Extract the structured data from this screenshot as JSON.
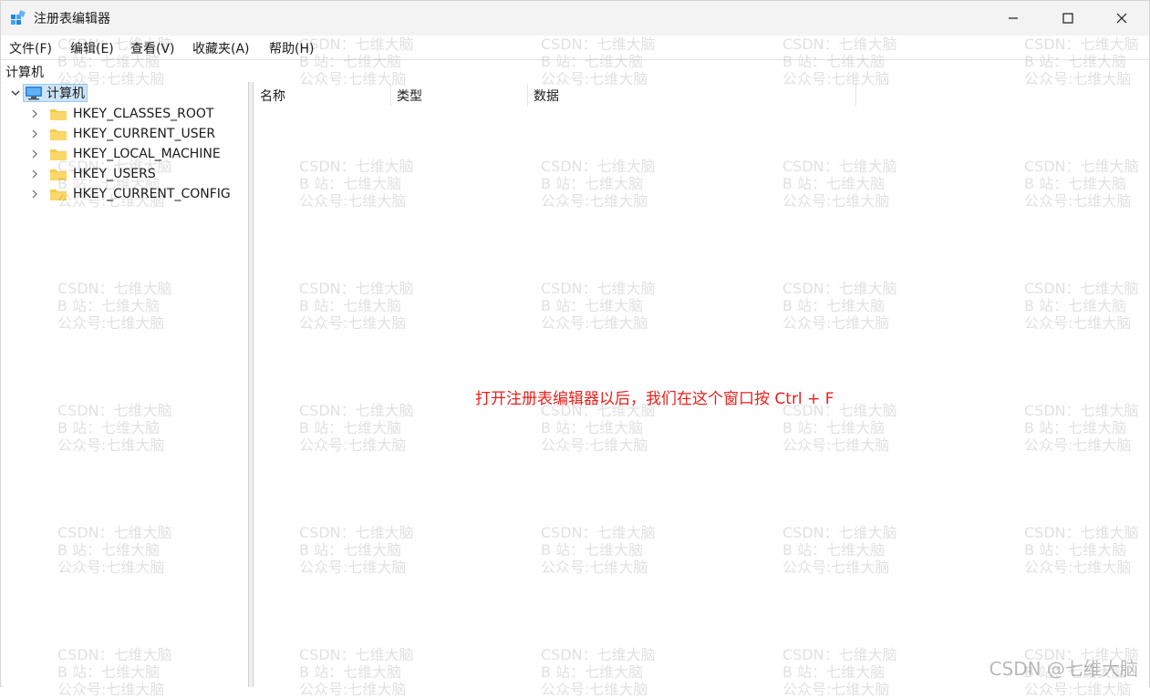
{
  "window": {
    "title": "注册表编辑器"
  },
  "menu": [
    {
      "label": "文件(F)"
    },
    {
      "label": "编辑(E)"
    },
    {
      "label": "查看(V)"
    },
    {
      "label": "收藏夹(A)"
    },
    {
      "label": "帮助(H)"
    }
  ],
  "address": "计算机",
  "tree": {
    "root": "计算机",
    "hives": [
      {
        "label": "HKEY_CLASSES_ROOT"
      },
      {
        "label": "HKEY_CURRENT_USER"
      },
      {
        "label": "HKEY_LOCAL_MACHINE"
      },
      {
        "label": "HKEY_USERS"
      },
      {
        "label": "HKEY_CURRENT_CONFIG"
      }
    ]
  },
  "columns": [
    {
      "label": "名称"
    },
    {
      "label": "类型"
    },
    {
      "label": "数据"
    }
  ],
  "annotation": "打开注册表编辑器以后，我们在这个窗口按 Ctrl + F",
  "watermark": {
    "line1": "CSDN：七维大脑",
    "line2": "B 站：七维大脑",
    "line3": "公众号:七维大脑",
    "corner": "CSDN @七维大脑"
  },
  "colors": {
    "annotation": "#e8201c",
    "selection": "#cce4f7",
    "folder": "#f8c94a"
  }
}
